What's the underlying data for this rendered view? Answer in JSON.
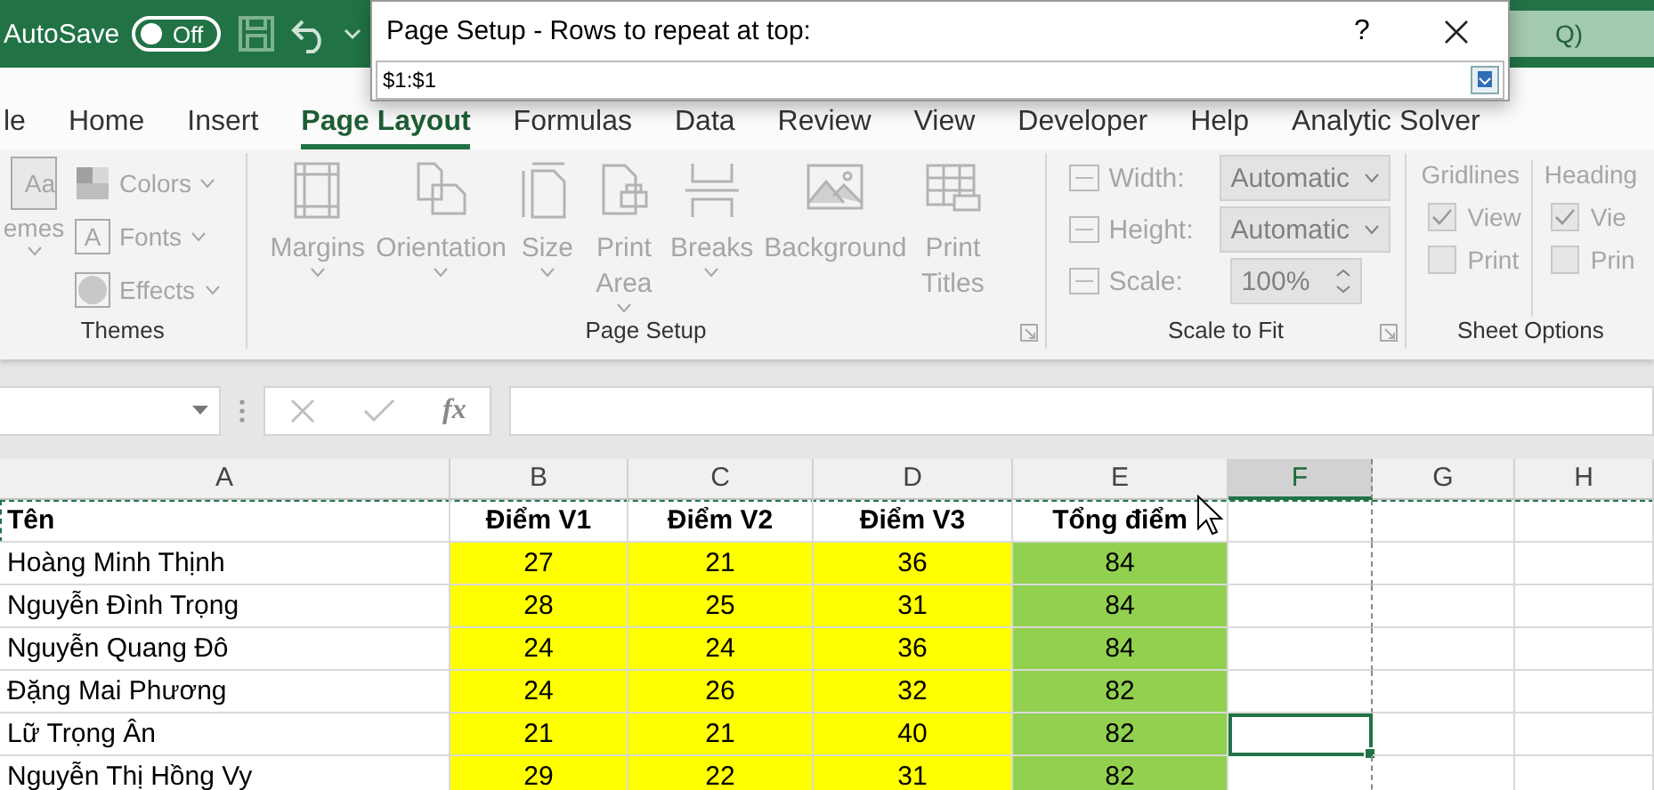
{
  "title_bar": {
    "autosave_label": "AutoSave",
    "autosave_toggle": {
      "label": "Off",
      "on": false
    },
    "search_hint": "Q)"
  },
  "tabs": [
    {
      "label": "le",
      "selected": false
    },
    {
      "label": "Home",
      "selected": false
    },
    {
      "label": "Insert",
      "selected": false
    },
    {
      "label": "Page Layout",
      "selected": true
    },
    {
      "label": "Formulas",
      "selected": false
    },
    {
      "label": "Data",
      "selected": false
    },
    {
      "label": "Review",
      "selected": false
    },
    {
      "label": "View",
      "selected": false
    },
    {
      "label": "Developer",
      "selected": false
    },
    {
      "label": "Help",
      "selected": false
    },
    {
      "label": "Analytic Solver",
      "selected": false
    }
  ],
  "ribbon": {
    "disabled": true,
    "themes": {
      "label": "Themes",
      "big_button": {
        "label": "emes",
        "icon_text": "Aa"
      },
      "items": [
        {
          "label": "Colors",
          "kind": "colors"
        },
        {
          "label": "Fonts",
          "kind": "fonts",
          "icon_text": "A"
        },
        {
          "label": "Effects",
          "kind": "effects"
        }
      ]
    },
    "page_setup": {
      "label": "Page Setup",
      "buttons": [
        {
          "label": "Margins",
          "kind": "margins",
          "dropdown": true
        },
        {
          "label": "Orientation",
          "kind": "orientation",
          "dropdown": true
        },
        {
          "label": "Size",
          "kind": "size",
          "dropdown": true
        },
        {
          "label": "Print Area",
          "kind": "printarea",
          "dropdown": true
        },
        {
          "label": "Breaks",
          "kind": "breaks",
          "dropdown": true
        },
        {
          "label": "Background",
          "kind": "background",
          "dropdown": false
        },
        {
          "label": "Print Titles",
          "kind": "printtitles",
          "dropdown": false
        }
      ]
    },
    "scale_to_fit": {
      "label": "Scale to Fit",
      "rows": [
        {
          "label": "Width:",
          "value": "Automatic",
          "kind": "select"
        },
        {
          "label": "Height:",
          "value": "Automatic",
          "kind": "select"
        },
        {
          "label": "Scale:",
          "value": "100%",
          "kind": "spin"
        }
      ]
    },
    "sheet_options": {
      "label": "Sheet Options",
      "columns": [
        {
          "heading": "Gridlines",
          "view": {
            "label": "View",
            "checked": true
          },
          "print": {
            "label": "Print",
            "checked": false
          }
        },
        {
          "heading": "Heading",
          "view": {
            "label": "Vie",
            "checked": true
          },
          "print": {
            "label": "Prin",
            "checked": false
          }
        }
      ]
    }
  },
  "formula_bar": {
    "function_label": "fx"
  },
  "sheet": {
    "columns": [
      {
        "label": "A",
        "selected": false,
        "page_break_after": false
      },
      {
        "label": "B",
        "selected": false,
        "color": "#ffff00",
        "page_break_after": false
      },
      {
        "label": "C",
        "selected": false,
        "color": "#ffff00",
        "page_break_after": false
      },
      {
        "label": "D",
        "selected": false,
        "color": "#ffff00",
        "page_break_after": false
      },
      {
        "label": "E",
        "selected": false,
        "color": "#92d050",
        "page_break_after": false
      },
      {
        "label": "F",
        "selected": true,
        "page_break_after": true
      },
      {
        "label": "G",
        "selected": false,
        "page_break_after": false
      },
      {
        "label": "H",
        "selected": false,
        "page_break_after": false
      }
    ],
    "rows": [
      {
        "kind": "header",
        "repeat_marked": true,
        "selected": false,
        "cells": [
          "Tên",
          "Điểm V1",
          "Điểm V2",
          "Điểm V3",
          "Tổng điểm"
        ]
      },
      {
        "kind": "data",
        "repeat_marked": false,
        "selected": false,
        "cells": [
          "Hoàng Minh Thịnh",
          "27",
          "21",
          "36",
          "84"
        ]
      },
      {
        "kind": "data",
        "repeat_marked": false,
        "selected": false,
        "cells": [
          "Nguyễn Đình Trọng",
          "28",
          "25",
          "31",
          "84"
        ]
      },
      {
        "kind": "data",
        "repeat_marked": false,
        "selected": false,
        "cells": [
          "Nguyễn Quang Đô",
          "24",
          "24",
          "36",
          "84"
        ]
      },
      {
        "kind": "data",
        "repeat_marked": false,
        "selected": false,
        "cells": [
          "Đặng Mai Phương",
          "24",
          "26",
          "32",
          "82"
        ]
      },
      {
        "kind": "data",
        "repeat_marked": false,
        "selected": true,
        "cells": [
          "Lữ Trọng Ân",
          "21",
          "21",
          "40",
          "82"
        ]
      },
      {
        "kind": "data",
        "repeat_marked": false,
        "selected": false,
        "cells": [
          "Nguyễn Thị Hồng Vy",
          "29",
          "22",
          "31",
          "82"
        ]
      }
    ]
  },
  "dialog": {
    "title": "Page Setup - Rows to repeat at top:",
    "help": "?",
    "value": "$1:$1"
  }
}
